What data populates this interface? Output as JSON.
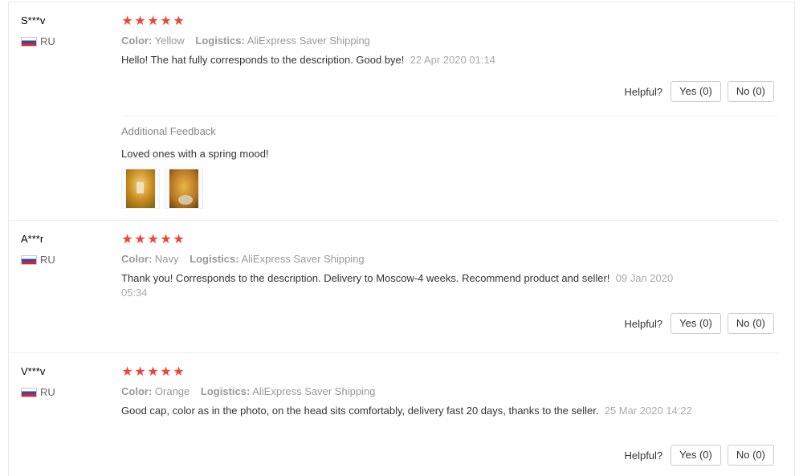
{
  "reviews": [
    {
      "user": "S***v",
      "country": "RU",
      "color_label": "Color:",
      "color_value": "Yellow",
      "logistics_label": "Logistics:",
      "logistics_value": "AliExpress Saver Shipping",
      "text": "Hello! The hat fully corresponds to the description. Good bye!",
      "date": "22 Apr 2020 01:14",
      "rating": 5,
      "helpful_label": "Helpful?",
      "yes_label": "Yes (0)",
      "no_label": "No (0)",
      "additional": {
        "title": "Additional Feedback",
        "text": "Loved ones with a spring mood!",
        "images": [
          "photo-1",
          "photo-2"
        ]
      }
    },
    {
      "user": "A***r",
      "country": "RU",
      "color_label": "Color:",
      "color_value": "Navy",
      "logistics_label": "Logistics:",
      "logistics_value": "AliExpress Saver Shipping",
      "text": "Thank you! Corresponds to the description. Delivery to Moscow-4 weeks. Recommend product and seller!",
      "date": "09 Jan 2020 05:34",
      "rating": 5,
      "helpful_label": "Helpful?",
      "yes_label": "Yes (0)",
      "no_label": "No (0)"
    },
    {
      "user": "V***v",
      "country": "RU",
      "color_label": "Color:",
      "color_value": "Orange",
      "logistics_label": "Logistics:",
      "logistics_value": "AliExpress Saver Shipping",
      "text": "Good cap, color as in the photo, on the head sits comfortably, delivery fast 20 days, thanks to the seller.",
      "date": "25 Mar 2020 14:22",
      "rating": 5,
      "helpful_label": "Helpful?",
      "yes_label": "Yes (0)",
      "no_label": "No (0)"
    }
  ],
  "colors": {
    "star": "#f44336",
    "muted": "#999999",
    "text": "#333333"
  },
  "icons": {
    "star": "star-icon",
    "flag": "russia-flag-icon"
  }
}
